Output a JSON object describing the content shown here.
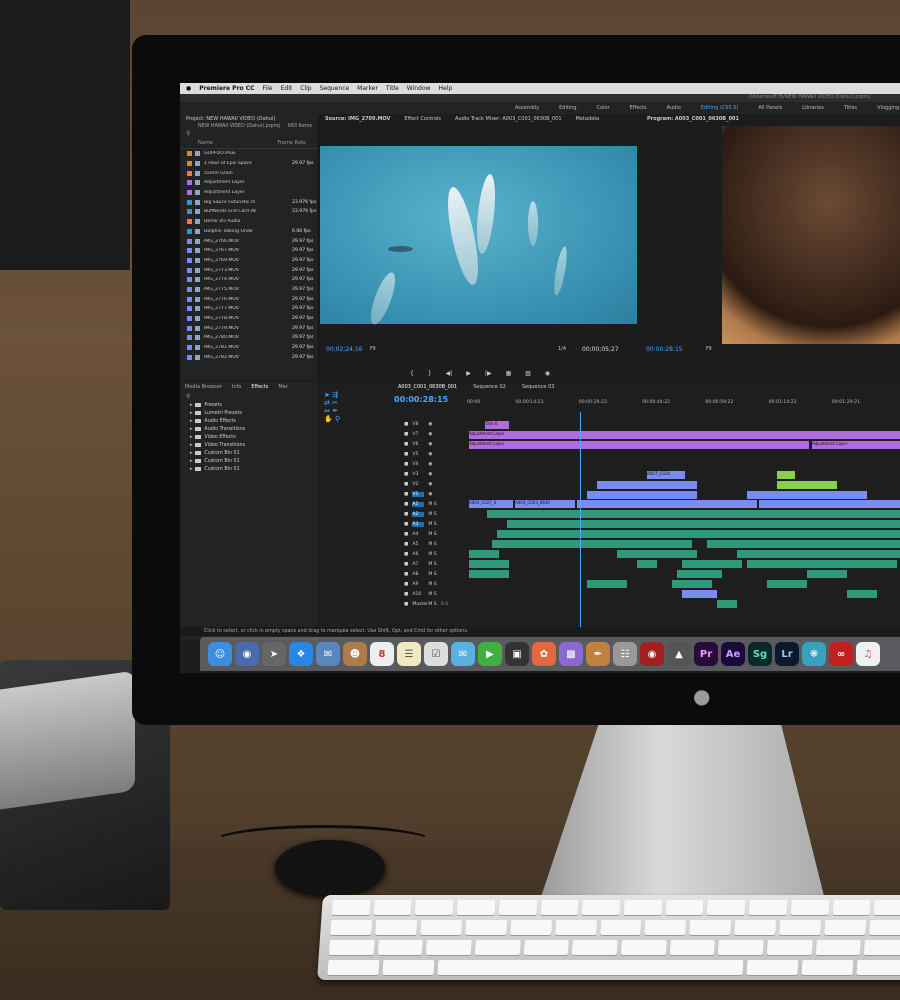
{
  "menubar": {
    "app_name": "Premiere Pro CC",
    "menus": [
      "File",
      "Edit",
      "Clip",
      "Sequence",
      "Marker",
      "Title",
      "Window",
      "Help"
    ]
  },
  "title_path": "/Volumes/8TB/NEW HAWAII VIDEO (Dahui).prproj",
  "workspaces": [
    "Assembly",
    "Editing",
    "Color",
    "Effects",
    "Audio",
    "Editing (CS5.5)",
    "All Panels",
    "Libraries",
    "Titles",
    "Vlogging"
  ],
  "project": {
    "tab": "Project: NEW HAWAII VIDEO (Dahui)",
    "file": "NEW HAWAII VIDEO (Dahui).prproj",
    "item_count": "683 Items",
    "col_name": "Name",
    "col_rate": "Frame Rate",
    "items": [
      {
        "name": "GOPFOOTAGE",
        "rate": "",
        "color": "#e0842a"
      },
      {
        "name": "1 Hour of Epic Space",
        "rate": "29.97 fps",
        "color": "#e0842a"
      },
      {
        "name": "55mm Grain",
        "rate": "",
        "color": "#e0842a"
      },
      {
        "name": "Adjustment Layer",
        "rate": "",
        "color": "#b06be0"
      },
      {
        "name": "Adjustment Layer",
        "rate": "",
        "color": "#b06be0"
      },
      {
        "name": "Big Sauce Futuristic.m",
        "rate": "23.976 fps",
        "color": "#2f9ac0"
      },
      {
        "name": "BuffNerds End Card (N",
        "rate": "23.976 fps",
        "color": "#2f9ac0"
      },
      {
        "name": "Derek VO Audio",
        "rate": "",
        "color": "#e0842a"
      },
      {
        "name": "Dolphin Talking Unde",
        "rate": "6.00 fps",
        "color": "#2f9ac0"
      },
      {
        "name": "IMG_2766.MOV",
        "rate": "29.97 fps",
        "color": "#7a8cf0"
      },
      {
        "name": "IMG_2767.MOV",
        "rate": "29.97 fps",
        "color": "#7a8cf0"
      },
      {
        "name": "IMG_2769.MOV",
        "rate": "29.97 fps",
        "color": "#7a8cf0"
      },
      {
        "name": "IMG_2773.MOV",
        "rate": "29.97 fps",
        "color": "#7a8cf0"
      },
      {
        "name": "IMG_2774.MOV",
        "rate": "29.97 fps",
        "color": "#7a8cf0"
      },
      {
        "name": "IMG_2775.MOV",
        "rate": "29.97 fps",
        "color": "#7a8cf0"
      },
      {
        "name": "IMG_2776.MOV",
        "rate": "29.97 fps",
        "color": "#7a8cf0"
      },
      {
        "name": "IMG_2777.MOV",
        "rate": "29.97 fps",
        "color": "#7a8cf0"
      },
      {
        "name": "IMG_2778.MOV",
        "rate": "29.97 fps",
        "color": "#7a8cf0"
      },
      {
        "name": "IMG_2779.MOV",
        "rate": "29.97 fps",
        "color": "#7a8cf0"
      },
      {
        "name": "IMG_2780.MOV",
        "rate": "29.97 fps",
        "color": "#7a8cf0"
      },
      {
        "name": "IMG_2781.MOV",
        "rate": "29.97 fps",
        "color": "#7a8cf0"
      },
      {
        "name": "IMG_2782.MOV",
        "rate": "29.97 fps",
        "color": "#7a8cf0"
      }
    ]
  },
  "source": {
    "tabs": [
      "Source: IMG_2709.MOV",
      "Effect Controls",
      "Audio Track Mixer: A003_C001_0630B_001",
      "Metadata"
    ],
    "timecode": "00;02;24;16",
    "fit": "Fit",
    "scale": "1/4",
    "duration": "00;00;05;27"
  },
  "program": {
    "tab": "Program: A003_C001_0630B_001",
    "timecode": "00:00:28:15",
    "fit": "Fit"
  },
  "effects": {
    "tabs": [
      "Media Browser",
      "Info",
      "Effects",
      "Mar"
    ],
    "items": [
      "Presets",
      "Lumetri Presets",
      "Audio Effects",
      "Audio Transitions",
      "Video Effects",
      "Video Transitions",
      "Custom Bin 01",
      "Custom Bin 01",
      "Custom Bin 01"
    ]
  },
  "timeline": {
    "tabs": [
      "A003_C001_0630B_001",
      "Sequence 02",
      "Sequence 03"
    ],
    "timecode": "00:00:28:15",
    "ruler": [
      "00:00",
      "00:00:14:23",
      "00:00:29:23",
      "00:00:44:22",
      "00:00:59:22",
      "00:01:14:22",
      "00:01:29:21"
    ],
    "tracks": [
      "V8",
      "V7",
      "V6",
      "V5",
      "V4",
      "V3",
      "V2",
      "V1",
      "A1",
      "A2",
      "A3",
      "A4",
      "A5",
      "A6",
      "A7",
      "A8",
      "A9",
      "A10",
      "Master"
    ],
    "master_value": "0.0",
    "clip_labels": {
      "title": "Title 0",
      "adj1": "Adjustment Layer",
      "adj2": "Adjustment Layer",
      "adj3": "Adjustment Layer",
      "c1": "A007_C024",
      "c2": "A003_C027_0",
      "c3": "A003_C003_0630"
    }
  },
  "status": "Click to select, or click in empty space and drag to marquee select. Use Shift, Opt, and Cmd for other options.",
  "dock": [
    "Pr",
    "Ae",
    "Sg",
    "Lr"
  ]
}
